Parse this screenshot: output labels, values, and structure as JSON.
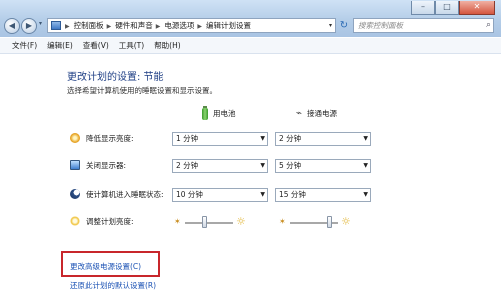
{
  "window": {
    "min_label": "–",
    "max_label": "□",
    "close_label": "✕",
    "back_label": "◀",
    "forward_label": "▶",
    "refresh_glyph": "↻",
    "search_glyph": "⌕",
    "dropdown_glyph": "▾"
  },
  "address": {
    "crumbs": [
      "控制面板",
      "硬件和声音",
      "电源选项",
      "编辑计划设置"
    ],
    "separator": "▶"
  },
  "search": {
    "placeholder": "搜索控制面板"
  },
  "menu": [
    "文件(F)",
    "编辑(E)",
    "查看(V)",
    "工具(T)",
    "帮助(H)"
  ],
  "page": {
    "title": "更改计划的设置: 节能",
    "description": "选择希望计算机使用的睡眠设置和显示设置。"
  },
  "columns": {
    "battery": "用电池",
    "plugged": "接通电源"
  },
  "settings": [
    {
      "label": "降低显示亮度:",
      "battery": "1 分钟",
      "plugged": "2 分钟"
    },
    {
      "label": "关闭显示器:",
      "battery": "2 分钟",
      "plugged": "5 分钟"
    },
    {
      "label": "使计算机进入睡眠状态:",
      "battery": "10 分钟",
      "plugged": "15 分钟"
    }
  ],
  "brightness": {
    "label": "调整计划亮度:",
    "battery_level": 0.4,
    "plugged_level": 0.85
  },
  "links": {
    "advanced": "更改高级电源设置(C)",
    "restore": "还原此计划的默认设置(R)"
  },
  "colors": {
    "title": "#1f3f85",
    "link": "#1b52b4",
    "highlight_box": "#c8262b"
  },
  "icons": {
    "dim": "sun-dim-icon",
    "monitor": "monitor-icon",
    "sleep": "moon-icon",
    "brightness": "sun-icon",
    "battery": "battery-icon",
    "plug": "plug-icon"
  }
}
